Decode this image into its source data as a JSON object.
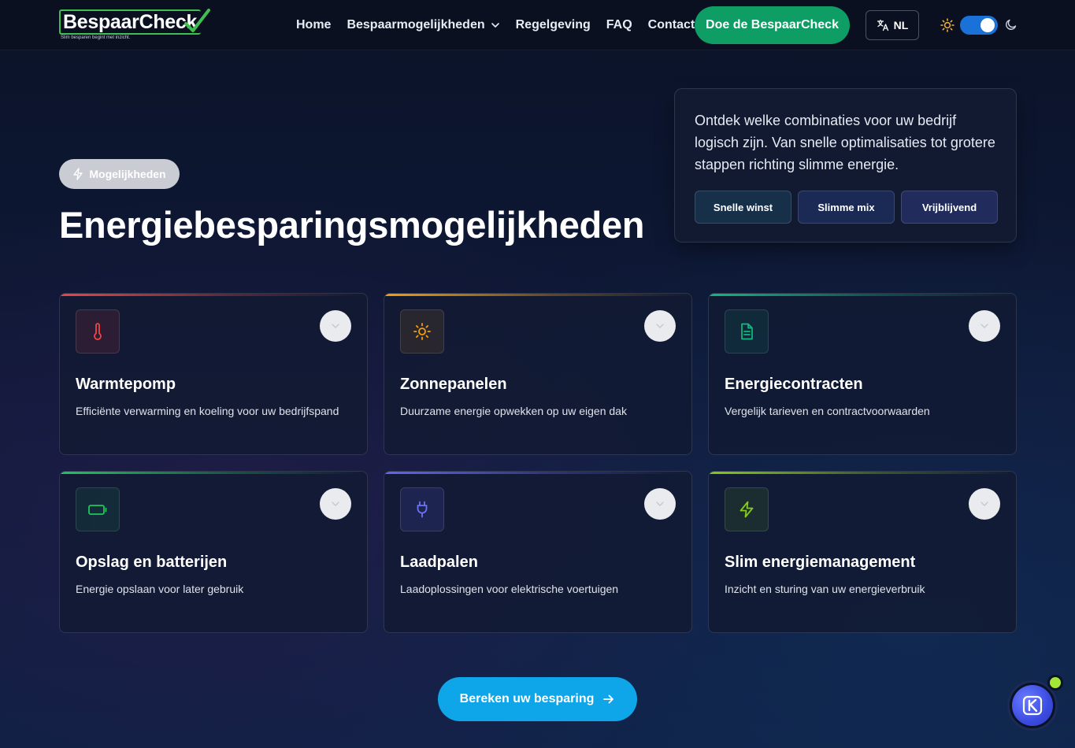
{
  "brand": {
    "name": "BespaarCheck",
    "tagline": "Slim besparen begint met inzicht.",
    "accent": "#3fbf4f"
  },
  "nav": {
    "links": [
      {
        "label": "Home"
      },
      {
        "label": "Bespaarmogelijkheden",
        "has_dropdown": true
      },
      {
        "label": "Regelgeving"
      },
      {
        "label": "FAQ"
      },
      {
        "label": "Contact"
      }
    ],
    "cta_label": "Doe de BespaarCheck",
    "cta_color": "#0f9d66",
    "language": "NL",
    "theme_toggle_on": true
  },
  "hero": {
    "badge": "Mogelijkheden",
    "title": "Energiebesparingsmogelijkheden"
  },
  "info_card": {
    "text": "Ontdek welke combinaties voor uw bedrijf logisch zijn. Van snelle optimalisaties tot grotere stappen richting slimme energie.",
    "chips": [
      "Snelle winst",
      "Slimme mix",
      "Vrijblijvend"
    ]
  },
  "cards": [
    {
      "title": "Warmtepomp",
      "desc": "Efficiënte verwarming en koeling voor uw bedrijfspand",
      "icon": "thermometer-icon",
      "color": "#ef4444"
    },
    {
      "title": "Zonnepanelen",
      "desc": "Duurzame energie opwekken op uw eigen dak",
      "icon": "sun-icon",
      "color": "#f59e0b"
    },
    {
      "title": "Energiecontracten",
      "desc": "Vergelijk tarieven en contractvoorwaarden",
      "icon": "document-icon",
      "color": "#10b981"
    },
    {
      "title": "Opslag en batterijen",
      "desc": "Energie opslaan voor later gebruik",
      "icon": "battery-icon",
      "color": "#22c55e"
    },
    {
      "title": "Laadpalen",
      "desc": "Laadoplossingen voor elektrische voertuigen",
      "icon": "plug-icon",
      "color": "#6366f1"
    },
    {
      "title": "Slim energiemanagement",
      "desc": "Inzicht en sturing van uw energieverbruik",
      "icon": "lightning-icon",
      "color": "#84cc16"
    }
  ],
  "calculate_button": "Bereken uw besparing",
  "calculate_color": "#0ea5e9"
}
